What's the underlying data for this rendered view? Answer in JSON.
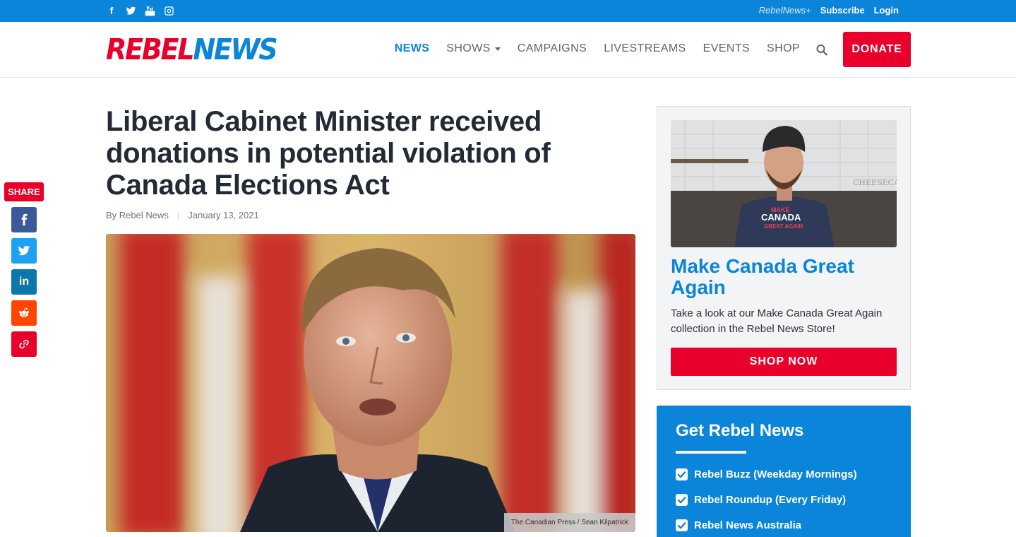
{
  "topbar": {
    "social": [
      {
        "icon": "facebook-icon",
        "glyph": "f"
      },
      {
        "icon": "twitter-icon"
      },
      {
        "icon": "youtube-icon"
      },
      {
        "icon": "instagram-icon"
      }
    ],
    "rebelnews_plus": "RebelNews+",
    "subscribe": "Subscribe",
    "login": "Login"
  },
  "header": {
    "logo_part1": "REBEL",
    "logo_part2": "NEWS",
    "nav": [
      {
        "label": "NEWS",
        "active": true
      },
      {
        "label": "SHOWS",
        "dropdown": true
      },
      {
        "label": "CAMPAIGNS"
      },
      {
        "label": "LIVESTREAMS"
      },
      {
        "label": "EVENTS"
      },
      {
        "label": "SHOP"
      }
    ],
    "search_icon": "search-icon",
    "donate": "DONATE"
  },
  "article": {
    "title": "Liberal Cabinet Minister received donations in potential violation of Canada Elections Act",
    "author": "By Rebel News",
    "date": "January 13, 2021",
    "photo_credit": "The Canadian Press / Sean Kilpatrick"
  },
  "share": {
    "label": "SHARE",
    "buttons": [
      {
        "icon": "facebook-icon",
        "color": "#3b5998"
      },
      {
        "icon": "twitter-icon",
        "color": "#1da1f2"
      },
      {
        "icon": "linkedin-icon",
        "color": "#0e76a8",
        "glyph": "in"
      },
      {
        "icon": "reddit-icon",
        "color": "#ff4500"
      },
      {
        "icon": "link-icon",
        "color": "#e8002b"
      }
    ]
  },
  "promo": {
    "title": "Make Canada Great Again",
    "text": "Take a look at our Make Canada Great Again collection in the Rebel News Store!",
    "button": "SHOP NOW",
    "shirt_text_1": "MAKE",
    "shirt_text_2": "CANADA",
    "shirt_text_3": "GREAT AGAIN",
    "wall_sign": "CHEESECAKE"
  },
  "newsletter": {
    "title": "Get Rebel News",
    "options": [
      {
        "label": "Rebel Buzz (Weekday Mornings)",
        "checked": true
      },
      {
        "label": "Rebel Roundup (Every Friday)",
        "checked": true
      },
      {
        "label": "Rebel News Australia",
        "checked": true
      }
    ]
  },
  "colors": {
    "brand_blue": "#0a85d9",
    "brand_red": "#e8002b",
    "headline": "#222a35"
  }
}
